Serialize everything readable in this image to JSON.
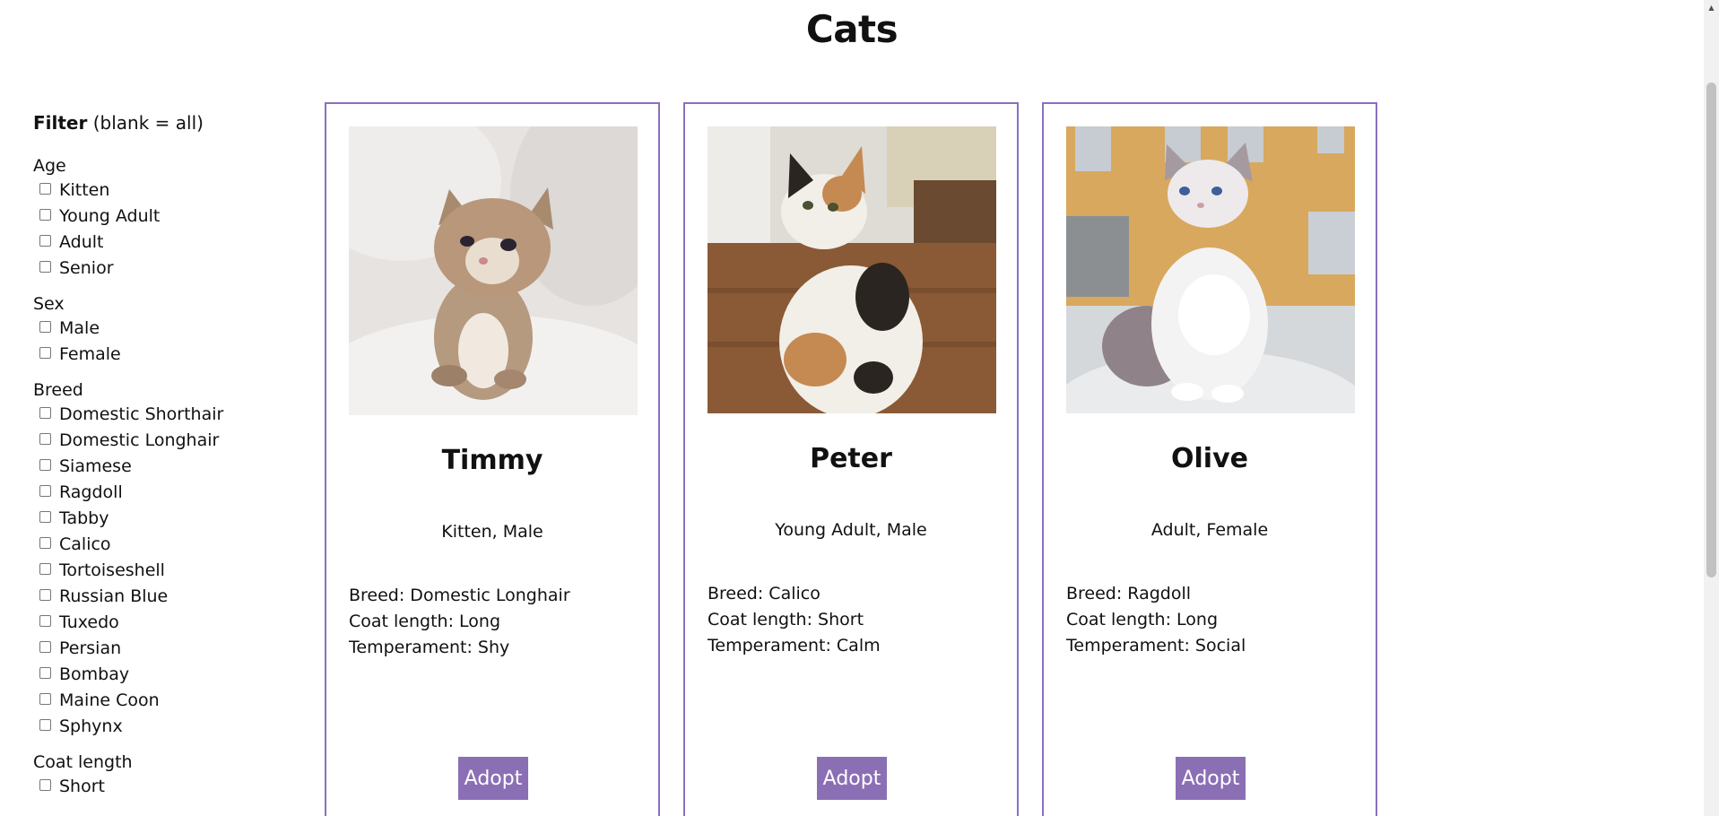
{
  "page": {
    "title": "Cats"
  },
  "filter": {
    "heading_bold": "Filter",
    "heading_rest": "(blank = all)",
    "groups": [
      {
        "title": "Age",
        "options": [
          "Kitten",
          "Young Adult",
          "Adult",
          "Senior"
        ]
      },
      {
        "title": "Sex",
        "options": [
          "Male",
          "Female"
        ]
      },
      {
        "title": "Breed",
        "options": [
          "Domestic Shorthair",
          "Domestic Longhair",
          "Siamese",
          "Ragdoll",
          "Tabby",
          "Calico",
          "Tortoiseshell",
          "Russian Blue",
          "Tuxedo",
          "Persian",
          "Bombay",
          "Maine Coon",
          "Sphynx"
        ]
      },
      {
        "title": "Coat length",
        "options": [
          "Short"
        ]
      }
    ]
  },
  "cats": [
    {
      "name": "Timmy",
      "summary": "Kitten, Male",
      "breed": "Breed: Domestic Longhair",
      "coat": "Coat length: Long",
      "temperament": "Temperament: Shy",
      "adopt_label": "Adopt",
      "photo_icon": "kitten-photo"
    },
    {
      "name": "Peter",
      "summary": "Young Adult, Male",
      "breed": "Breed: Calico",
      "coat": "Coat length: Short",
      "temperament": "Temperament: Calm",
      "adopt_label": "Adopt",
      "photo_icon": "calico-cat-photo"
    },
    {
      "name": "Olive",
      "summary": "Adult, Female",
      "breed": "Breed: Ragdoll",
      "coat": "Coat length: Long",
      "temperament": "Temperament: Social",
      "adopt_label": "Adopt",
      "photo_icon": "ragdoll-cat-photo"
    }
  ],
  "colors": {
    "card_border": "#8b6fc1",
    "button_bg": "#8b6fb5",
    "button_text": "#ffffff"
  }
}
